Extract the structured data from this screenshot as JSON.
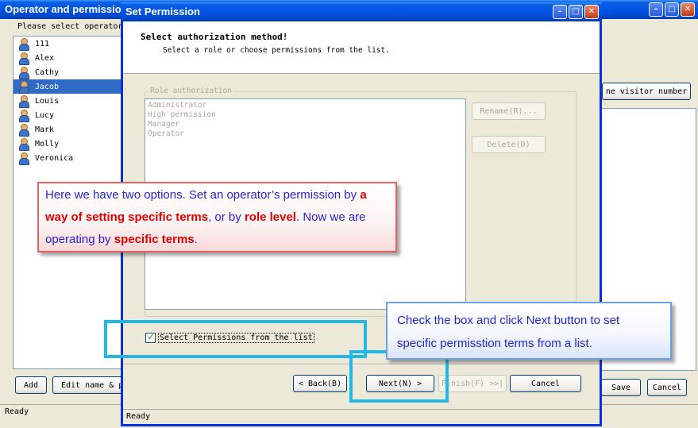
{
  "back_window": {
    "title": "Operator and permission",
    "prompt": "Please select operator",
    "operators": [
      "111",
      "Alex",
      "Cathy",
      "Jacob",
      "Louis",
      "Lucy",
      "Mark",
      "Molly",
      "Veronica"
    ],
    "selected_operator": "Jacob",
    "visitor_number_button": "ne visitor number",
    "add_button": "Add",
    "edit_button": "Edit name & p",
    "save_button": "Save",
    "cancel_button": "Cancel",
    "status": "Ready"
  },
  "dialog": {
    "title": "Set Permission",
    "heading": "Select authorization method!",
    "subheading": "Select a role or choose permissions from the list.",
    "role_group_label": "Role authorization",
    "roles": [
      "Administrator",
      "High permission",
      "Manager",
      "Operator"
    ],
    "rename_button": "Rename(R)...",
    "delete_button": "Delete(D)",
    "checkbox_label": "Select Permissions from the list",
    "checkbox_checked": true,
    "back_button": "< Back(B)",
    "next_button": "Next(N) >",
    "finish_button": "Finish(F) >>|",
    "cancel_button": "Cancel",
    "status": "Ready"
  },
  "callout_red": {
    "p1": "Here we have two options. Set an operator’s permission by ",
    "h1": "a way of setting specific terms",
    "p2": ", or by ",
    "h2": "role level",
    "p3": ". Now we are operating  by ",
    "h3": "specific terms",
    "p4": "."
  },
  "callout_blue": {
    "text": "Check the box and click Next button to set specific permisstion terms from a list."
  },
  "colors": {
    "titlebar_blue": "#0054E3",
    "selection": "#316AC5",
    "highlight_box": "#22B8E6",
    "callout_red_border": "#E46464",
    "callout_blue_border": "#6B9FE6",
    "callout_text": "#2424D0",
    "callout_highlight": "#E00000"
  }
}
